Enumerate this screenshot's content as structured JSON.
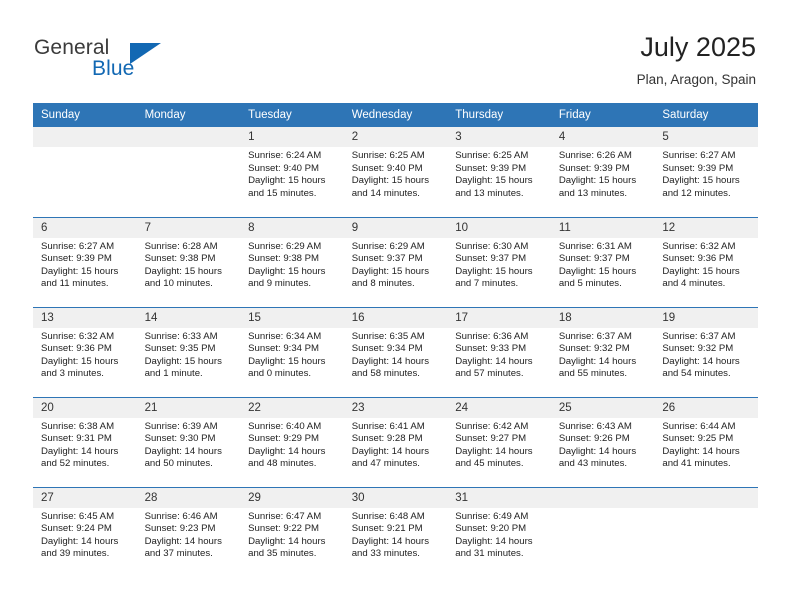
{
  "brand": {
    "name_dark": "General",
    "name_blue": "Blue",
    "accent_color": "#1268b3",
    "header_color": "#2e75b6"
  },
  "header": {
    "title": "July 2025",
    "subtitle": "Plan, Aragon, Spain"
  },
  "calendar": {
    "weekday_headers": [
      "Sunday",
      "Monday",
      "Tuesday",
      "Wednesday",
      "Thursday",
      "Friday",
      "Saturday"
    ],
    "labels": {
      "sunrise": "Sunrise:",
      "sunset": "Sunset:",
      "daylight": "Daylight:"
    },
    "weeks": [
      [
        {
          "day": "",
          "sunrise": "",
          "sunset": "",
          "daylight_line1": "",
          "daylight_line2": ""
        },
        {
          "day": "",
          "sunrise": "",
          "sunset": "",
          "daylight_line1": "",
          "daylight_line2": ""
        },
        {
          "day": "1",
          "sunrise": "Sunrise: 6:24 AM",
          "sunset": "Sunset: 9:40 PM",
          "daylight_line1": "Daylight: 15 hours",
          "daylight_line2": "and 15 minutes."
        },
        {
          "day": "2",
          "sunrise": "Sunrise: 6:25 AM",
          "sunset": "Sunset: 9:40 PM",
          "daylight_line1": "Daylight: 15 hours",
          "daylight_line2": "and 14 minutes."
        },
        {
          "day": "3",
          "sunrise": "Sunrise: 6:25 AM",
          "sunset": "Sunset: 9:39 PM",
          "daylight_line1": "Daylight: 15 hours",
          "daylight_line2": "and 13 minutes."
        },
        {
          "day": "4",
          "sunrise": "Sunrise: 6:26 AM",
          "sunset": "Sunset: 9:39 PM",
          "daylight_line1": "Daylight: 15 hours",
          "daylight_line2": "and 13 minutes."
        },
        {
          "day": "5",
          "sunrise": "Sunrise: 6:27 AM",
          "sunset": "Sunset: 9:39 PM",
          "daylight_line1": "Daylight: 15 hours",
          "daylight_line2": "and 12 minutes."
        }
      ],
      [
        {
          "day": "6",
          "sunrise": "Sunrise: 6:27 AM",
          "sunset": "Sunset: 9:39 PM",
          "daylight_line1": "Daylight: 15 hours",
          "daylight_line2": "and 11 minutes."
        },
        {
          "day": "7",
          "sunrise": "Sunrise: 6:28 AM",
          "sunset": "Sunset: 9:38 PM",
          "daylight_line1": "Daylight: 15 hours",
          "daylight_line2": "and 10 minutes."
        },
        {
          "day": "8",
          "sunrise": "Sunrise: 6:29 AM",
          "sunset": "Sunset: 9:38 PM",
          "daylight_line1": "Daylight: 15 hours",
          "daylight_line2": "and 9 minutes."
        },
        {
          "day": "9",
          "sunrise": "Sunrise: 6:29 AM",
          "sunset": "Sunset: 9:37 PM",
          "daylight_line1": "Daylight: 15 hours",
          "daylight_line2": "and 8 minutes."
        },
        {
          "day": "10",
          "sunrise": "Sunrise: 6:30 AM",
          "sunset": "Sunset: 9:37 PM",
          "daylight_line1": "Daylight: 15 hours",
          "daylight_line2": "and 7 minutes."
        },
        {
          "day": "11",
          "sunrise": "Sunrise: 6:31 AM",
          "sunset": "Sunset: 9:37 PM",
          "daylight_line1": "Daylight: 15 hours",
          "daylight_line2": "and 5 minutes."
        },
        {
          "day": "12",
          "sunrise": "Sunrise: 6:32 AM",
          "sunset": "Sunset: 9:36 PM",
          "daylight_line1": "Daylight: 15 hours",
          "daylight_line2": "and 4 minutes."
        }
      ],
      [
        {
          "day": "13",
          "sunrise": "Sunrise: 6:32 AM",
          "sunset": "Sunset: 9:36 PM",
          "daylight_line1": "Daylight: 15 hours",
          "daylight_line2": "and 3 minutes."
        },
        {
          "day": "14",
          "sunrise": "Sunrise: 6:33 AM",
          "sunset": "Sunset: 9:35 PM",
          "daylight_line1": "Daylight: 15 hours",
          "daylight_line2": "and 1 minute."
        },
        {
          "day": "15",
          "sunrise": "Sunrise: 6:34 AM",
          "sunset": "Sunset: 9:34 PM",
          "daylight_line1": "Daylight: 15 hours",
          "daylight_line2": "and 0 minutes."
        },
        {
          "day": "16",
          "sunrise": "Sunrise: 6:35 AM",
          "sunset": "Sunset: 9:34 PM",
          "daylight_line1": "Daylight: 14 hours",
          "daylight_line2": "and 58 minutes."
        },
        {
          "day": "17",
          "sunrise": "Sunrise: 6:36 AM",
          "sunset": "Sunset: 9:33 PM",
          "daylight_line1": "Daylight: 14 hours",
          "daylight_line2": "and 57 minutes."
        },
        {
          "day": "18",
          "sunrise": "Sunrise: 6:37 AM",
          "sunset": "Sunset: 9:32 PM",
          "daylight_line1": "Daylight: 14 hours",
          "daylight_line2": "and 55 minutes."
        },
        {
          "day": "19",
          "sunrise": "Sunrise: 6:37 AM",
          "sunset": "Sunset: 9:32 PM",
          "daylight_line1": "Daylight: 14 hours",
          "daylight_line2": "and 54 minutes."
        }
      ],
      [
        {
          "day": "20",
          "sunrise": "Sunrise: 6:38 AM",
          "sunset": "Sunset: 9:31 PM",
          "daylight_line1": "Daylight: 14 hours",
          "daylight_line2": "and 52 minutes."
        },
        {
          "day": "21",
          "sunrise": "Sunrise: 6:39 AM",
          "sunset": "Sunset: 9:30 PM",
          "daylight_line1": "Daylight: 14 hours",
          "daylight_line2": "and 50 minutes."
        },
        {
          "day": "22",
          "sunrise": "Sunrise: 6:40 AM",
          "sunset": "Sunset: 9:29 PM",
          "daylight_line1": "Daylight: 14 hours",
          "daylight_line2": "and 48 minutes."
        },
        {
          "day": "23",
          "sunrise": "Sunrise: 6:41 AM",
          "sunset": "Sunset: 9:28 PM",
          "daylight_line1": "Daylight: 14 hours",
          "daylight_line2": "and 47 minutes."
        },
        {
          "day": "24",
          "sunrise": "Sunrise: 6:42 AM",
          "sunset": "Sunset: 9:27 PM",
          "daylight_line1": "Daylight: 14 hours",
          "daylight_line2": "and 45 minutes."
        },
        {
          "day": "25",
          "sunrise": "Sunrise: 6:43 AM",
          "sunset": "Sunset: 9:26 PM",
          "daylight_line1": "Daylight: 14 hours",
          "daylight_line2": "and 43 minutes."
        },
        {
          "day": "26",
          "sunrise": "Sunrise: 6:44 AM",
          "sunset": "Sunset: 9:25 PM",
          "daylight_line1": "Daylight: 14 hours",
          "daylight_line2": "and 41 minutes."
        }
      ],
      [
        {
          "day": "27",
          "sunrise": "Sunrise: 6:45 AM",
          "sunset": "Sunset: 9:24 PM",
          "daylight_line1": "Daylight: 14 hours",
          "daylight_line2": "and 39 minutes."
        },
        {
          "day": "28",
          "sunrise": "Sunrise: 6:46 AM",
          "sunset": "Sunset: 9:23 PM",
          "daylight_line1": "Daylight: 14 hours",
          "daylight_line2": "and 37 minutes."
        },
        {
          "day": "29",
          "sunrise": "Sunrise: 6:47 AM",
          "sunset": "Sunset: 9:22 PM",
          "daylight_line1": "Daylight: 14 hours",
          "daylight_line2": "and 35 minutes."
        },
        {
          "day": "30",
          "sunrise": "Sunrise: 6:48 AM",
          "sunset": "Sunset: 9:21 PM",
          "daylight_line1": "Daylight: 14 hours",
          "daylight_line2": "and 33 minutes."
        },
        {
          "day": "31",
          "sunrise": "Sunrise: 6:49 AM",
          "sunset": "Sunset: 9:20 PM",
          "daylight_line1": "Daylight: 14 hours",
          "daylight_line2": "and 31 minutes."
        },
        {
          "day": "",
          "sunrise": "",
          "sunset": "",
          "daylight_line1": "",
          "daylight_line2": ""
        },
        {
          "day": "",
          "sunrise": "",
          "sunset": "",
          "daylight_line1": "",
          "daylight_line2": ""
        }
      ]
    ]
  }
}
